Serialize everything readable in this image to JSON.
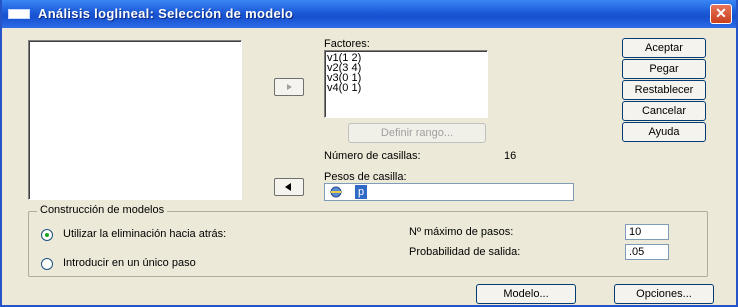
{
  "window": {
    "title": "Análisis loglineal: Selección de modelo",
    "close_glyph": "✕"
  },
  "factors": {
    "label": "Factores:",
    "items": [
      "v1(1 2)",
      "v2(3 4)",
      "v3(0 1)",
      "v4(0 1)"
    ],
    "define_range_label": "Definir rango...",
    "cells_label": "Número de casillas:",
    "cells_value": "16"
  },
  "weights": {
    "label": "Pesos de casilla:",
    "value": "p"
  },
  "side_buttons": {
    "ok": "Aceptar",
    "paste": "Pegar",
    "reset": "Restablecer",
    "cancel": "Cancelar",
    "help": "Ayuda"
  },
  "model_building": {
    "title": "Construcción de modelos",
    "option_backward": "Utilizar la eliminación hacia atrás:",
    "option_single": "Introducir en un único paso",
    "selected": "backward",
    "max_steps_label": "Nº máximo de pasos:",
    "max_steps_value": "10",
    "exit_prob_label": "Probabilidad de salida:",
    "exit_prob_value": ".05"
  },
  "bottom_buttons": {
    "model": "Modelo...",
    "options": "Opciones..."
  },
  "icons": {
    "move_right": "arrow-right-icon",
    "move_left": "arrow-left-icon",
    "variable": "scale-variable-icon"
  }
}
